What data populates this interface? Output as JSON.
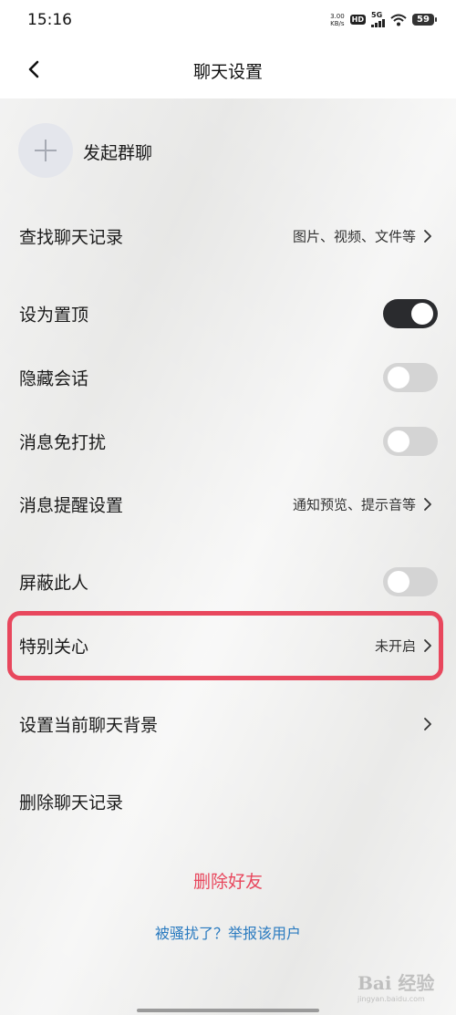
{
  "status_bar": {
    "time": "15:16",
    "net_speed_value": "3.00",
    "net_speed_unit": "KB/s",
    "hd_badge": "HD",
    "signal_label": "5G",
    "battery_level": "59"
  },
  "nav": {
    "title": "聊天设置",
    "back_icon": "chevron-left-icon"
  },
  "group_chat": {
    "label": "发起群聊",
    "icon": "plus-icon"
  },
  "rows": {
    "search_history": {
      "label": "查找聊天记录",
      "value": "图片、视频、文件等"
    },
    "pin_top": {
      "label": "设为置顶",
      "toggle": true
    },
    "hide_chat": {
      "label": "隐藏会话",
      "toggle": false
    },
    "do_not_disturb": {
      "label": "消息免打扰",
      "toggle": false
    },
    "reminder_settings": {
      "label": "消息提醒设置",
      "value": "通知预览、提示音等"
    },
    "block_user": {
      "label": "屏蔽此人",
      "toggle": false
    },
    "special_care": {
      "label": "特别关心",
      "value": "未开启"
    },
    "chat_background": {
      "label": "设置当前聊天背景"
    },
    "clear_history": {
      "label": "删除聊天记录"
    }
  },
  "actions": {
    "delete_friend": "删除好友",
    "report_user": "被骚扰了？举报该用户"
  },
  "watermark": {
    "brand": "Bai 经验",
    "site": "jingyan.baidu.com"
  },
  "colors": {
    "accent_red": "#e8475d",
    "link_blue": "#2b7bc0",
    "toggle_on": "#2a2b2e",
    "toggle_off": "#d4d4d4"
  }
}
